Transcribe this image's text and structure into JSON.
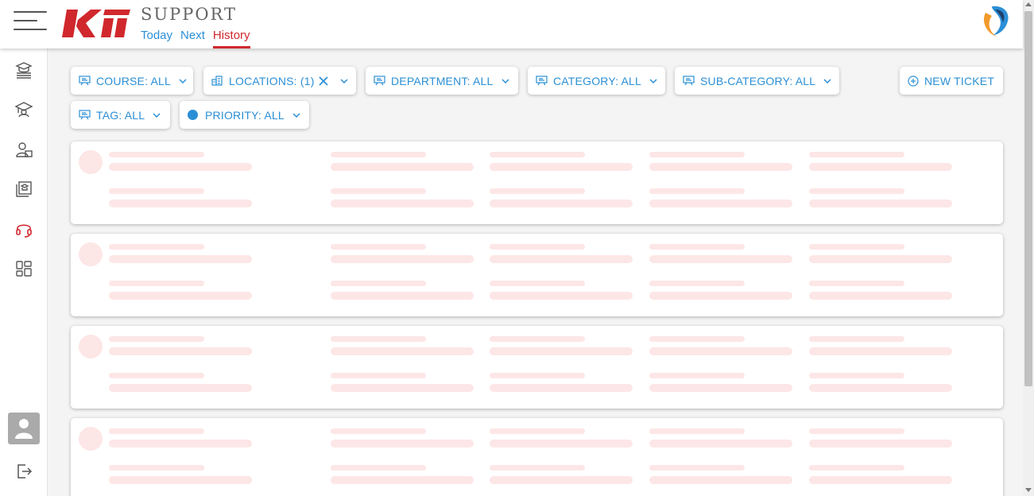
{
  "header": {
    "title": "SUPPORT",
    "tabs": [
      {
        "label": "Today",
        "active": false
      },
      {
        "label": "Next",
        "active": false
      },
      {
        "label": "History",
        "active": true
      }
    ]
  },
  "filters": {
    "course": "COURSE: ALL",
    "locations": "LOCATIONS: (1)",
    "department": "DEPARTMENT: ALL",
    "category": "CATEGORY: ALL",
    "subcategory": "SUB-CATEGORY: ALL",
    "tag": "TAG: ALL",
    "priority": "PRIORITY: ALL",
    "new_ticket": "NEW TICKET"
  },
  "sidebar": {
    "items": [
      {
        "icon": "courses-icon"
      },
      {
        "icon": "school-icon"
      },
      {
        "icon": "user-card-icon"
      },
      {
        "icon": "library-icon"
      },
      {
        "icon": "headset-icon",
        "active": true
      },
      {
        "icon": "dashboard-grid-icon"
      }
    ],
    "bottom": [
      {
        "icon": "avatar"
      },
      {
        "icon": "logout-icon"
      }
    ]
  },
  "loading_cards": 4,
  "colors": {
    "accent_blue": "#2b8fd6",
    "brand_red": "#d0282d",
    "skeleton": "#fde6e6",
    "priority_dot": "#2b8fd6"
  }
}
